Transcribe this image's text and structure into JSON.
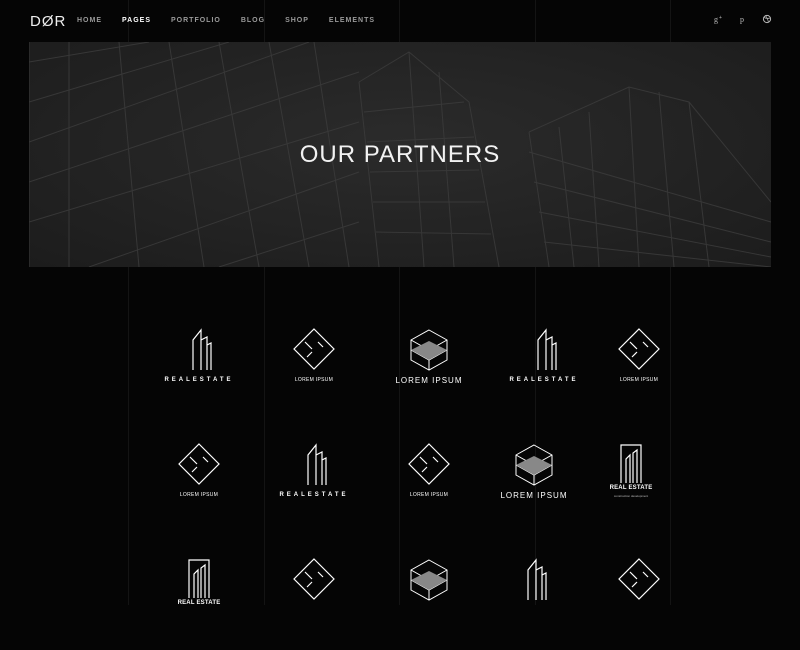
{
  "header": {
    "logo": "DØR",
    "nav": [
      "HOME",
      "PAGES",
      "PORTFOLIO",
      "BLOG",
      "SHOP",
      "ELEMENTS"
    ],
    "active_nav": "PAGES",
    "social": [
      "google-plus-icon",
      "pinterest-icon",
      "dribbble-icon"
    ]
  },
  "hero": {
    "title": "OUR PARTNERS"
  },
  "partners": {
    "rows": [
      [
        {
          "type": "building",
          "caption": "REALESTATE"
        },
        {
          "type": "diamond",
          "caption": "LOREM IPSUM"
        },
        {
          "type": "cube",
          "caption": "LOREM IPSUM"
        },
        {
          "type": "building",
          "caption": "REALESTATE"
        },
        {
          "type": "diamond",
          "caption": "LOREM IPSUM"
        }
      ],
      [
        {
          "type": "diamond",
          "caption": "LOREM IPSUM"
        },
        {
          "type": "building",
          "caption": "REALESTATE"
        },
        {
          "type": "diamond",
          "caption": "LOREM IPSUM"
        },
        {
          "type": "cube",
          "caption": "LOREM IPSUM"
        },
        {
          "type": "framed",
          "caption": "REAL ESTATE",
          "subcaption": "construction development"
        }
      ],
      [
        {
          "type": "framed",
          "caption": "REAL ESTATE"
        },
        {
          "type": "diamond",
          "caption": ""
        },
        {
          "type": "cube",
          "caption": ""
        },
        {
          "type": "building",
          "caption": ""
        },
        {
          "type": "diamond",
          "caption": ""
        }
      ]
    ]
  },
  "colors": {
    "background": "#050505",
    "hero": "#232323",
    "text": "#ffffff",
    "nav": "#9a9a9a"
  }
}
